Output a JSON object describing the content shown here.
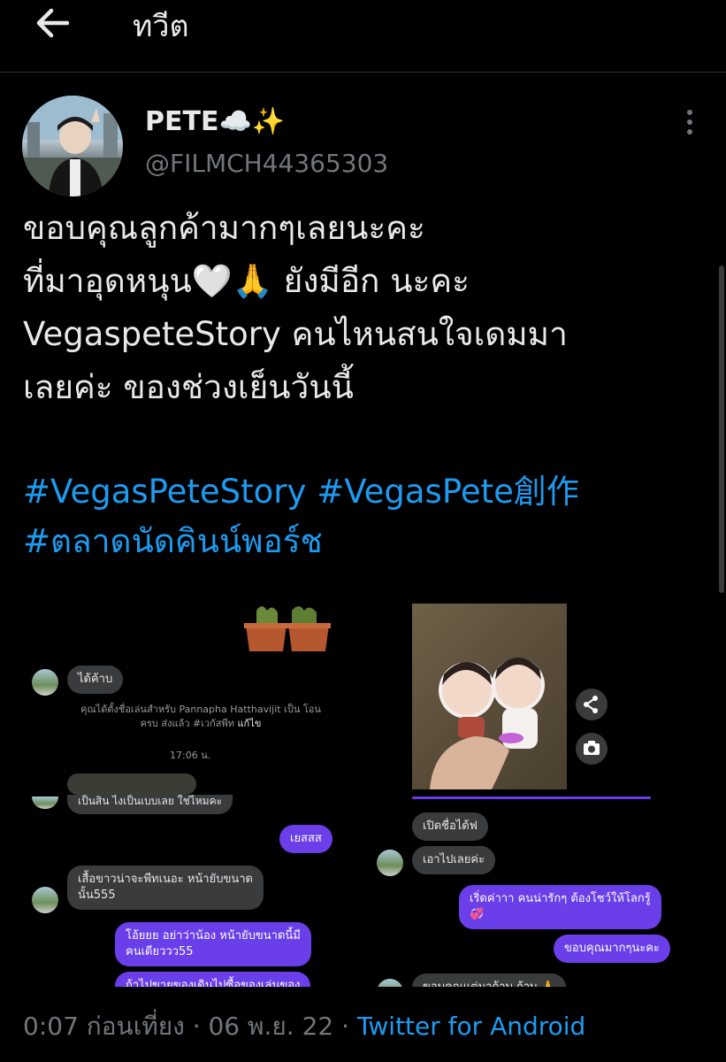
{
  "header": {
    "back_icon": "arrow-left-icon",
    "title": "ทวีต"
  },
  "tweet": {
    "author_name": "PETE☁️✨",
    "author_handle": "@FILMCH44365303",
    "more_icon": "vertical-dots-icon",
    "body_lines": [
      "ขอบคุณลูกค้ามากๆเลยนะคะ",
      "ที่มาอุดหนุน🤍🙏 ยังมีอีก นะคะ",
      "VegaspeteStory คนไหนสนใจเดมมา",
      "เลยค่ะ ของช่วงเย็นวันนี้"
    ],
    "hashtags": [
      "#VegasPeteStory",
      "#VegasPete創作",
      "#ตลาดนัดคินน์พอร์ช"
    ],
    "timestamp": "0:07 ก่อนเที่ยง · 06 พ.ย. 22 · ",
    "source": "Twitter for Android"
  },
  "media": {
    "left_chat": {
      "msg1": "ได้ค้าบ",
      "system_text": "คุณได้ตั้งชื่อเล่นสำหรับ Pannapha Hatthavijit เป็น โอน ครบ ส่งแล้ว #เวกัสพีท",
      "system_link": "แก้ไข",
      "time": "17:06 น.",
      "msg_cut": "เป็นสิน ไงเป็นเบบเลย ใช่ไหมคะ",
      "msg_purple1": "เยสสส",
      "msg_gray2_line1": "เสื้อขาวน่าจะพีทเนอะ หน้ายับขนาด",
      "msg_gray2_line2": "นั้น555",
      "msg_purple2_line1": "โอ้ยยย อย่าว่าน้อง หน้ายับขนาดนี้มี",
      "msg_purple2_line2": "คนเดียววว55",
      "msg_purple3_cut": "ถ้าไปขายของเดินไปซื้อของเล่นของ"
    },
    "right_chat": {
      "share_icon": "share-icon",
      "camera_icon": "camera-icon",
      "msg1": "เปิดชื่อได้ฟ",
      "msg2": "เอาไปเลยค่ะ",
      "msg_purple1_line1": "เริ่ดค่าาา คนน่ารักๆ ต้องโชว์ให้โลกรู้",
      "msg_purple1_line2": "💞",
      "msg_purple2": "ขอบคุณมากๆนะคะ",
      "msg_cut": "ขอบคุณแต่มาก้าบ ก้าบ 🙏"
    }
  }
}
